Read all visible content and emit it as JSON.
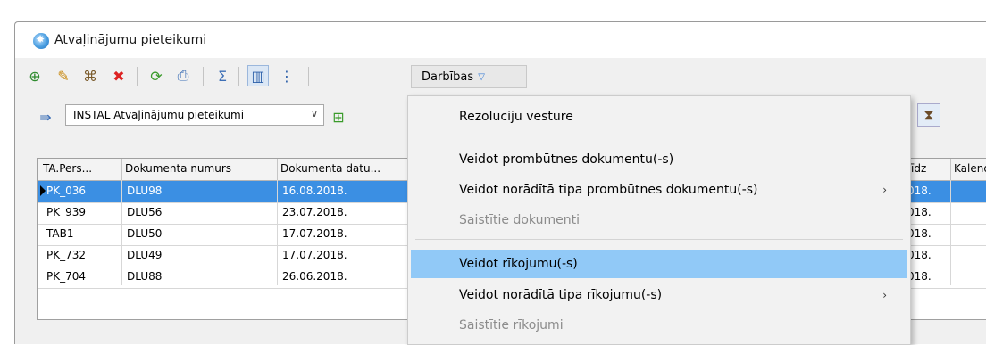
{
  "window": {
    "title": "Atvaļinājumu pieteikumi"
  },
  "toolbar": {
    "icons": [
      "add-icon",
      "edit-icon",
      "view-icon",
      "delete-icon",
      "refresh-icon",
      "print-icon",
      "sum-icon",
      "columns-icon",
      "tree-icon"
    ],
    "actions_label": "Darbības"
  },
  "selector": {
    "value": "INSTAL Atvaļinājumu pieteikumi"
  },
  "grid": {
    "columns": [
      "TA.Pers...",
      "Dokumenta numurs",
      "Dokumenta datu...",
      "īdz",
      "Kalend"
    ],
    "rows": [
      {
        "pers": "PK_036",
        "num": "DLU98",
        "date": "16.08.2018.",
        "tail": "018."
      },
      {
        "pers": "PK_939",
        "num": "DLU56",
        "date": "23.07.2018.",
        "tail": "018."
      },
      {
        "pers": "TAB1",
        "num": "DLU50",
        "date": "17.07.2018.",
        "tail": "018."
      },
      {
        "pers": "PK_732",
        "num": "DLU49",
        "date": "17.07.2018.",
        "tail": "018."
      },
      {
        "pers": "PK_704",
        "num": "DLU88",
        "date": "26.06.2018.",
        "tail": "018."
      }
    ]
  },
  "menu": {
    "items": [
      {
        "label": "Rezolūciju vēsture"
      },
      {
        "label": "Veidot prombūtnes dokumentu(-s)"
      },
      {
        "label": "Veidot norādītā tipa prombūtnes dokumentu(-s)"
      },
      {
        "label": "Saistītie dokumenti"
      },
      {
        "label": "Veidot rīkojumu(-s)"
      },
      {
        "label": "Veidot norādītā tipa rīkojumu(-s)"
      },
      {
        "label": "Saistītie rīkojumi"
      }
    ]
  },
  "colors": {
    "selection": "#3b8fe3",
    "menu_highlight": "#91c9f7"
  }
}
